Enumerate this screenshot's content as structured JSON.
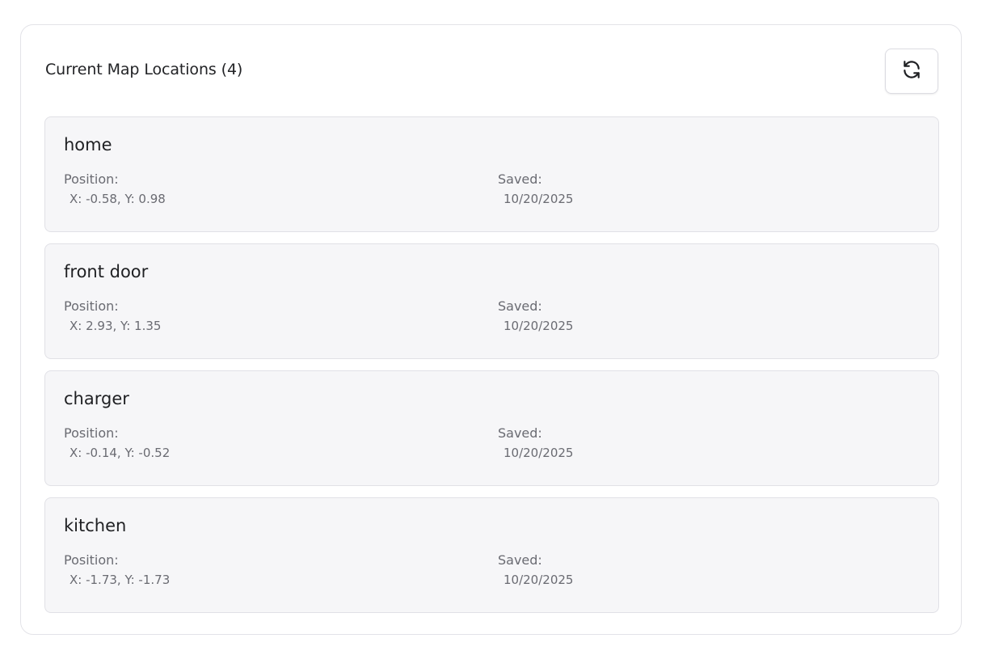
{
  "panel": {
    "title": "Current Map Locations (4)",
    "refresh_icon": "refresh-icon"
  },
  "labels": {
    "position": "Position:",
    "saved": "Saved:"
  },
  "locations": [
    {
      "name": "home",
      "position": "X: -0.58, Y: 0.98",
      "saved": "10/20/2025"
    },
    {
      "name": "front door",
      "position": "X: 2.93, Y: 1.35",
      "saved": "10/20/2025"
    },
    {
      "name": "charger",
      "position": "X: -0.14, Y: -0.52",
      "saved": "10/20/2025"
    },
    {
      "name": "kitchen",
      "position": "X: -1.73, Y: -1.73",
      "saved": "10/20/2025"
    }
  ]
}
